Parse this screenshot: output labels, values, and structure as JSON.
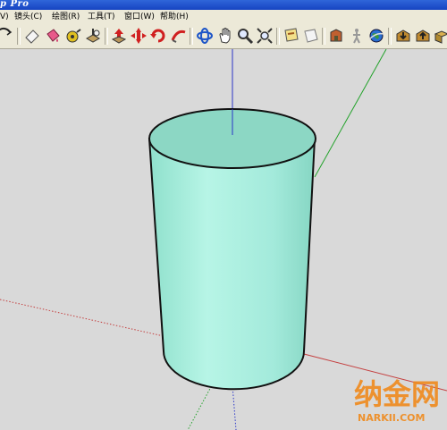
{
  "window": {
    "title_fragment": "p Pro"
  },
  "menu": {
    "items": [
      {
        "label": "V)"
      },
      {
        "label": "镜头(C)"
      },
      {
        "label": "绘图(R)"
      },
      {
        "label": "工具(T)"
      },
      {
        "label": "窗口(W)"
      },
      {
        "label": "帮助(H)"
      }
    ]
  },
  "toolbar": {
    "icons": [
      "orbit-partial-icon",
      "eraser-icon",
      "paint-bucket-icon",
      "tape-measure-icon",
      "push-pull-icon",
      "move-icon",
      "rotate-icon",
      "follow-me-icon",
      "orbit-icon",
      "pan-icon",
      "zoom-icon",
      "zoom-extents-icon",
      "section-plane-icon",
      "offset-icon",
      "model-icon",
      "walk-icon",
      "google-earth-icon",
      "get-models-icon",
      "share-model-icon",
      "components-icon"
    ]
  },
  "watermark": {
    "brand": "纳金网",
    "url": "NARKII.COM"
  },
  "colors": {
    "cylinder_fill": "#a7ecdc",
    "cylinder_top": "#8fd8c6",
    "axis_blue": "#2a35c8",
    "axis_green": "#22a22a",
    "axis_red": "#c44040",
    "background": "#d9d9d9"
  }
}
